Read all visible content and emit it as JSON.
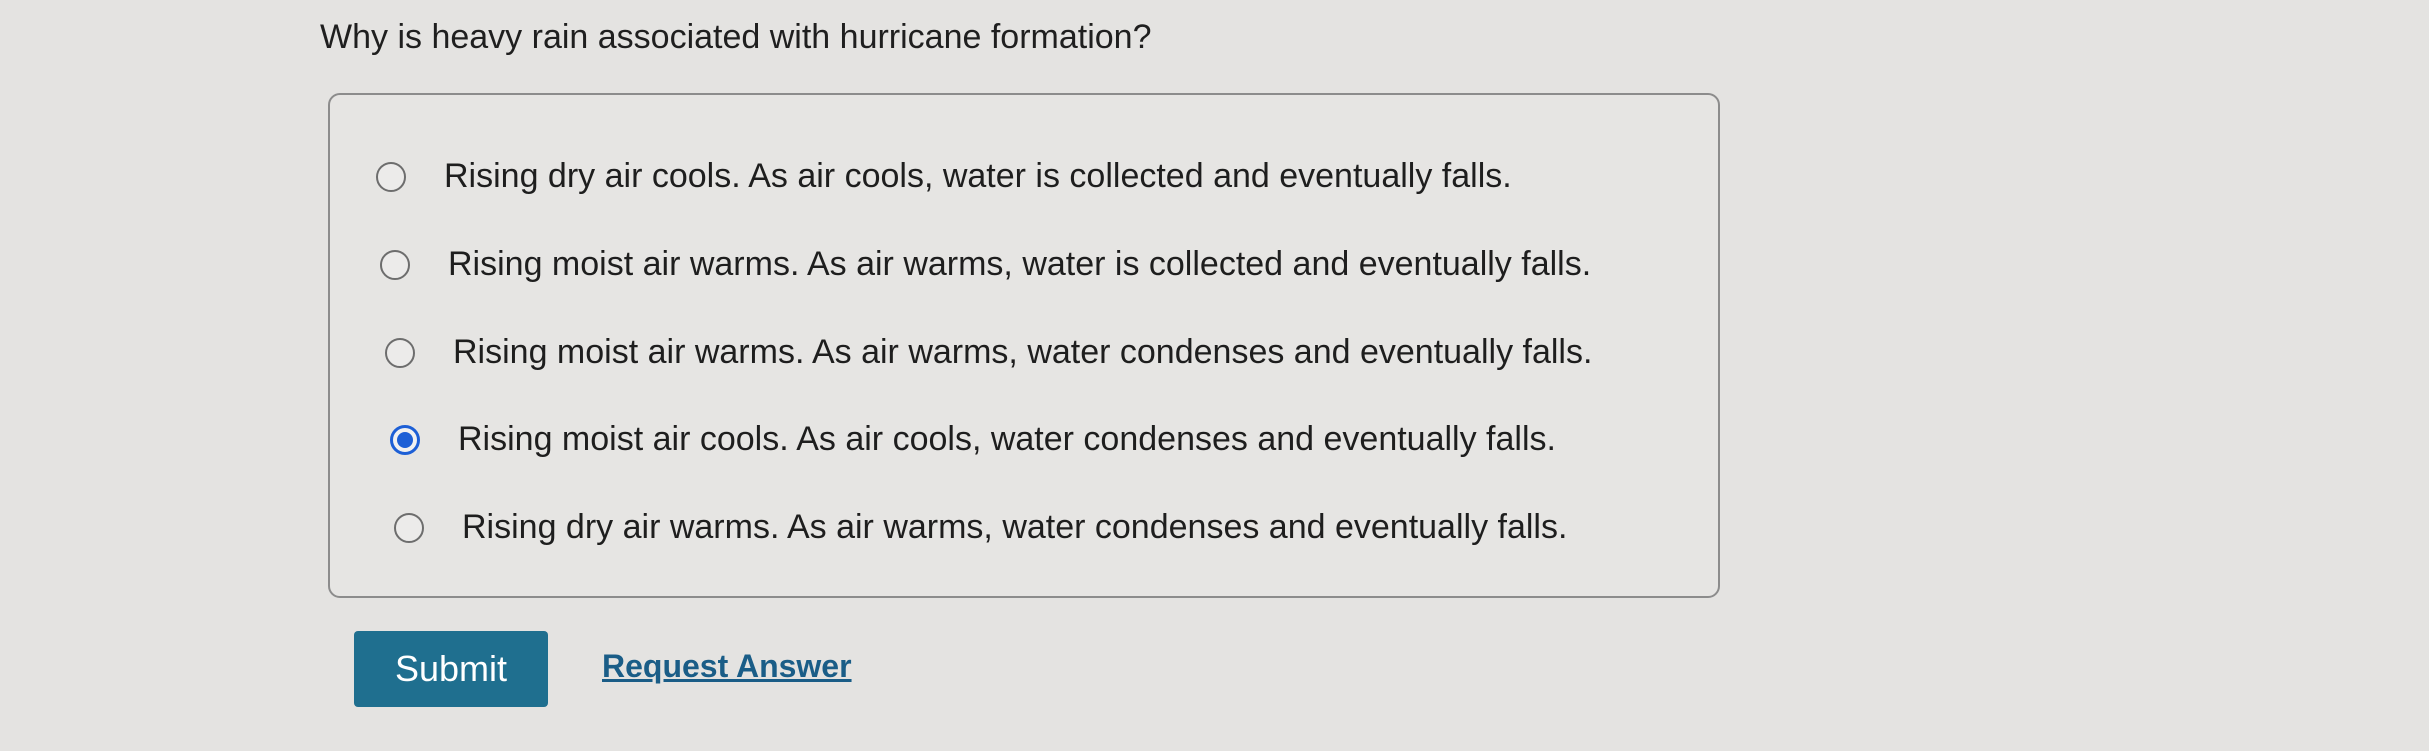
{
  "question": {
    "text": "Why is heavy rain associated with hurricane formation?"
  },
  "choices": [
    {
      "label": "Rising dry air cools. As air cools, water is collected and eventually falls.",
      "selected": false
    },
    {
      "label": "Rising moist air warms. As air warms, water is collected and eventually falls.",
      "selected": false
    },
    {
      "label": "Rising moist air warms. As air warms, water condenses and eventually falls.",
      "selected": false
    },
    {
      "label": "Rising moist air cools. As air cools, water condenses and eventually falls.",
      "selected": true
    },
    {
      "label": "Rising dry air warms. As air warms, water condenses and eventually falls.",
      "selected": false
    }
  ],
  "actions": {
    "submit_label": "Submit",
    "request_answer_label": "Request Answer"
  },
  "colors": {
    "background": "#e4e3e1",
    "accent_blue": "#1d5fd6",
    "submit_bg": "#1f6f8f",
    "link": "#1a5d87"
  }
}
